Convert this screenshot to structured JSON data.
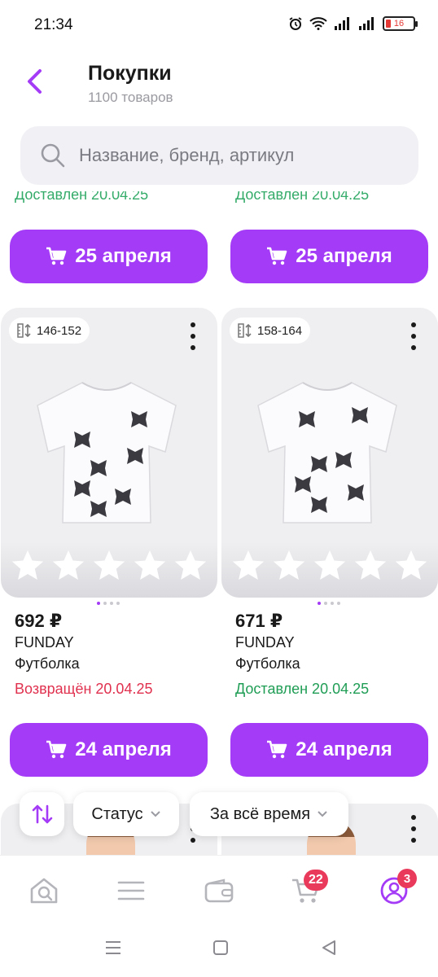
{
  "status_bar": {
    "time": "21:34",
    "battery": "16"
  },
  "header": {
    "title": "Покупки",
    "subtitle": "1100 товаров"
  },
  "search": {
    "placeholder": "Название, бренд, артикул"
  },
  "top_row": {
    "cut_status_left": "Доставлен 20.04.25",
    "cut_status_right": "Доставлен 20.04.25",
    "buttons": [
      {
        "label": "25 апреля"
      },
      {
        "label": "25 апреля"
      }
    ]
  },
  "products": [
    {
      "size": "146-152",
      "price": "692 ₽",
      "brand": "FUNDAY",
      "type": "Футболка",
      "status": "Возвращён 20.04.25",
      "status_kind": "returned",
      "action": "24 апреля",
      "rating_stars": 5
    },
    {
      "size": "158-164",
      "price": "671 ₽",
      "brand": "FUNDAY",
      "type": "Футболка",
      "status": "Доставлен 20.04.25",
      "status_kind": "delivered",
      "action": "24 апреля",
      "rating_stars": 5
    }
  ],
  "filters": {
    "status_label": "Статус",
    "period_label": "За всё время"
  },
  "bottom_nav": {
    "items": [
      "home-search",
      "catalog",
      "wallet",
      "cart",
      "profile"
    ],
    "cart_badge": "22",
    "profile_badge": "3"
  },
  "colors": {
    "accent": "#a43bf6",
    "returned": "#e0314f",
    "delivered": "#1f9d55",
    "badge": "#ea3a5c"
  }
}
